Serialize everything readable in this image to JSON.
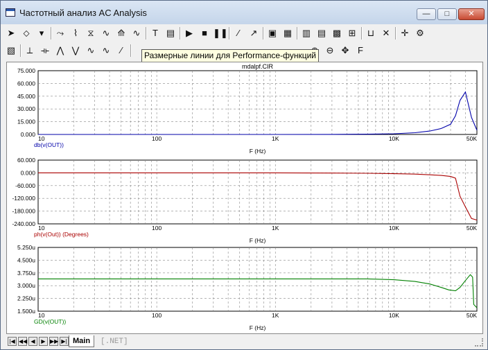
{
  "window": {
    "title": "Частотный анализ AC Analysis",
    "minimize": "—",
    "maximize": "□",
    "close": "✕"
  },
  "toolbar1": [
    {
      "name": "select-arrow-icon",
      "glyph": "➤"
    },
    {
      "name": "select-shapes-icon",
      "glyph": "⬦"
    },
    {
      "name": "dropdown-arrow-icon",
      "glyph": "▾"
    },
    {
      "name": "graph-scale-icon",
      "glyph": "⤳"
    },
    {
      "name": "scale-x-icon",
      "glyph": "⌇"
    },
    {
      "name": "scale-y-icon",
      "glyph": "⧖"
    },
    {
      "name": "data-points-icon",
      "glyph": "∿"
    },
    {
      "name": "curve-zoom-icon",
      "glyph": "⟰"
    },
    {
      "name": "fourier-icon",
      "glyph": "∿"
    },
    {
      "name": "text-icon",
      "glyph": "T"
    },
    {
      "name": "properties-icon",
      "glyph": "▤"
    },
    {
      "name": "run-icon",
      "glyph": "▶"
    },
    {
      "name": "stop-icon",
      "glyph": "■"
    },
    {
      "name": "pause-icon",
      "glyph": "❚❚"
    },
    {
      "name": "line-icon",
      "glyph": "∕"
    },
    {
      "name": "arrow-line-icon",
      "glyph": "↗"
    },
    {
      "name": "frame-icon",
      "glyph": "▣"
    },
    {
      "name": "grid-icon",
      "glyph": "▦"
    },
    {
      "name": "grid-v-icon",
      "glyph": "▥"
    },
    {
      "name": "grid-h-icon",
      "glyph": "▤"
    },
    {
      "name": "grid-minor-icon",
      "glyph": "▩"
    },
    {
      "name": "grid-tick-icon",
      "glyph": "⊞"
    },
    {
      "name": "axis-icon",
      "glyph": "⊔"
    },
    {
      "name": "cross-icon",
      "glyph": "✕"
    },
    {
      "name": "cursor-mode-icon",
      "glyph": "✛"
    },
    {
      "name": "settings-icon",
      "glyph": "⚙"
    }
  ],
  "toolbar2": [
    {
      "name": "chart-icon",
      "glyph": "▧"
    },
    {
      "name": "cursor-peak-icon",
      "glyph": "⟂"
    },
    {
      "name": "cursor-valley-icon",
      "glyph": "⟛"
    },
    {
      "name": "peak-icon",
      "glyph": "⋀"
    },
    {
      "name": "valley-icon",
      "glyph": "⋁"
    },
    {
      "name": "high-icon",
      "glyph": "∿"
    },
    {
      "name": "low-icon",
      "glyph": "∿"
    },
    {
      "name": "slope-icon",
      "glyph": "⁄"
    },
    {
      "name": "zoom-in-icon",
      "glyph": "⊕"
    },
    {
      "name": "zoom-out-icon",
      "glyph": "⊖"
    },
    {
      "name": "pan-icon",
      "glyph": "✥"
    },
    {
      "name": "font-icon",
      "glyph": "F"
    }
  ],
  "tooltip": "Размерные линии для Performance-функций",
  "plot_title": "mdalpf.CIR",
  "tabs": {
    "main": "Main",
    "net": "[.NET]"
  },
  "chart_data": [
    {
      "type": "line",
      "x_scale": "log",
      "xlim": [
        10,
        50000
      ],
      "x_ticks": [
        "10",
        "100",
        "1K",
        "10K",
        "50K"
      ],
      "x_label": "F (Hz)",
      "y_label": "db(v(OUT))",
      "ylim": [
        0,
        75
      ],
      "y_ticks": [
        "75.000",
        "60.000",
        "45.000",
        "30.000",
        "15.000",
        "0.000"
      ],
      "color": "#0000aa",
      "x": [
        10,
        100,
        1000,
        3000,
        6000,
        10000,
        15000,
        20000,
        25000,
        30000,
        33000,
        36000,
        40000,
        45000,
        50000
      ],
      "y": [
        0,
        0,
        0,
        0.1,
        0.3,
        0.8,
        2,
        4,
        7,
        12,
        22,
        40,
        50,
        20,
        5
      ]
    },
    {
      "type": "line",
      "x_scale": "log",
      "xlim": [
        10,
        50000
      ],
      "x_ticks": [
        "10",
        "100",
        "1K",
        "10K",
        "50K"
      ],
      "x_label": "F (Hz)",
      "y_label": "ph(v(Out)) (Degrees)",
      "ylim": [
        -240,
        60
      ],
      "y_ticks": [
        "60.000",
        "0.000",
        "-60.000",
        "-120.000",
        "-180.000",
        "-240.000"
      ],
      "color": "#aa0000",
      "x": [
        10,
        100,
        1000,
        3000,
        6000,
        10000,
        15000,
        20000,
        25000,
        30000,
        33000,
        36000,
        40000,
        45000,
        50000
      ],
      "y": [
        0,
        0,
        0,
        -1,
        -2,
        -4,
        -6,
        -9,
        -12,
        -17,
        -25,
        -110,
        -160,
        -215,
        -222
      ]
    },
    {
      "type": "line",
      "x_scale": "log",
      "xlim": [
        10,
        50000
      ],
      "x_ticks": [
        "10",
        "100",
        "1K",
        "10K",
        "50K"
      ],
      "x_label": "F (Hz)",
      "y_label": "GD(v(OUT))",
      "ylim": [
        1.5,
        5.25
      ],
      "y_ticks": [
        "5.250u",
        "4.500u",
        "3.750u",
        "3.000u",
        "2.250u",
        "1.500u"
      ],
      "color": "#008000",
      "x": [
        10,
        100,
        1000,
        3000,
        6000,
        10000,
        15000,
        20000,
        25000,
        29000,
        33000,
        36000,
        40000,
        44000,
        46000,
        47000,
        50000
      ],
      "y": [
        3.4,
        3.4,
        3.4,
        3.4,
        3.4,
        3.35,
        3.25,
        3.1,
        2.9,
        2.75,
        2.7,
        2.9,
        3.3,
        3.65,
        3.5,
        1.9,
        1.7
      ]
    }
  ]
}
